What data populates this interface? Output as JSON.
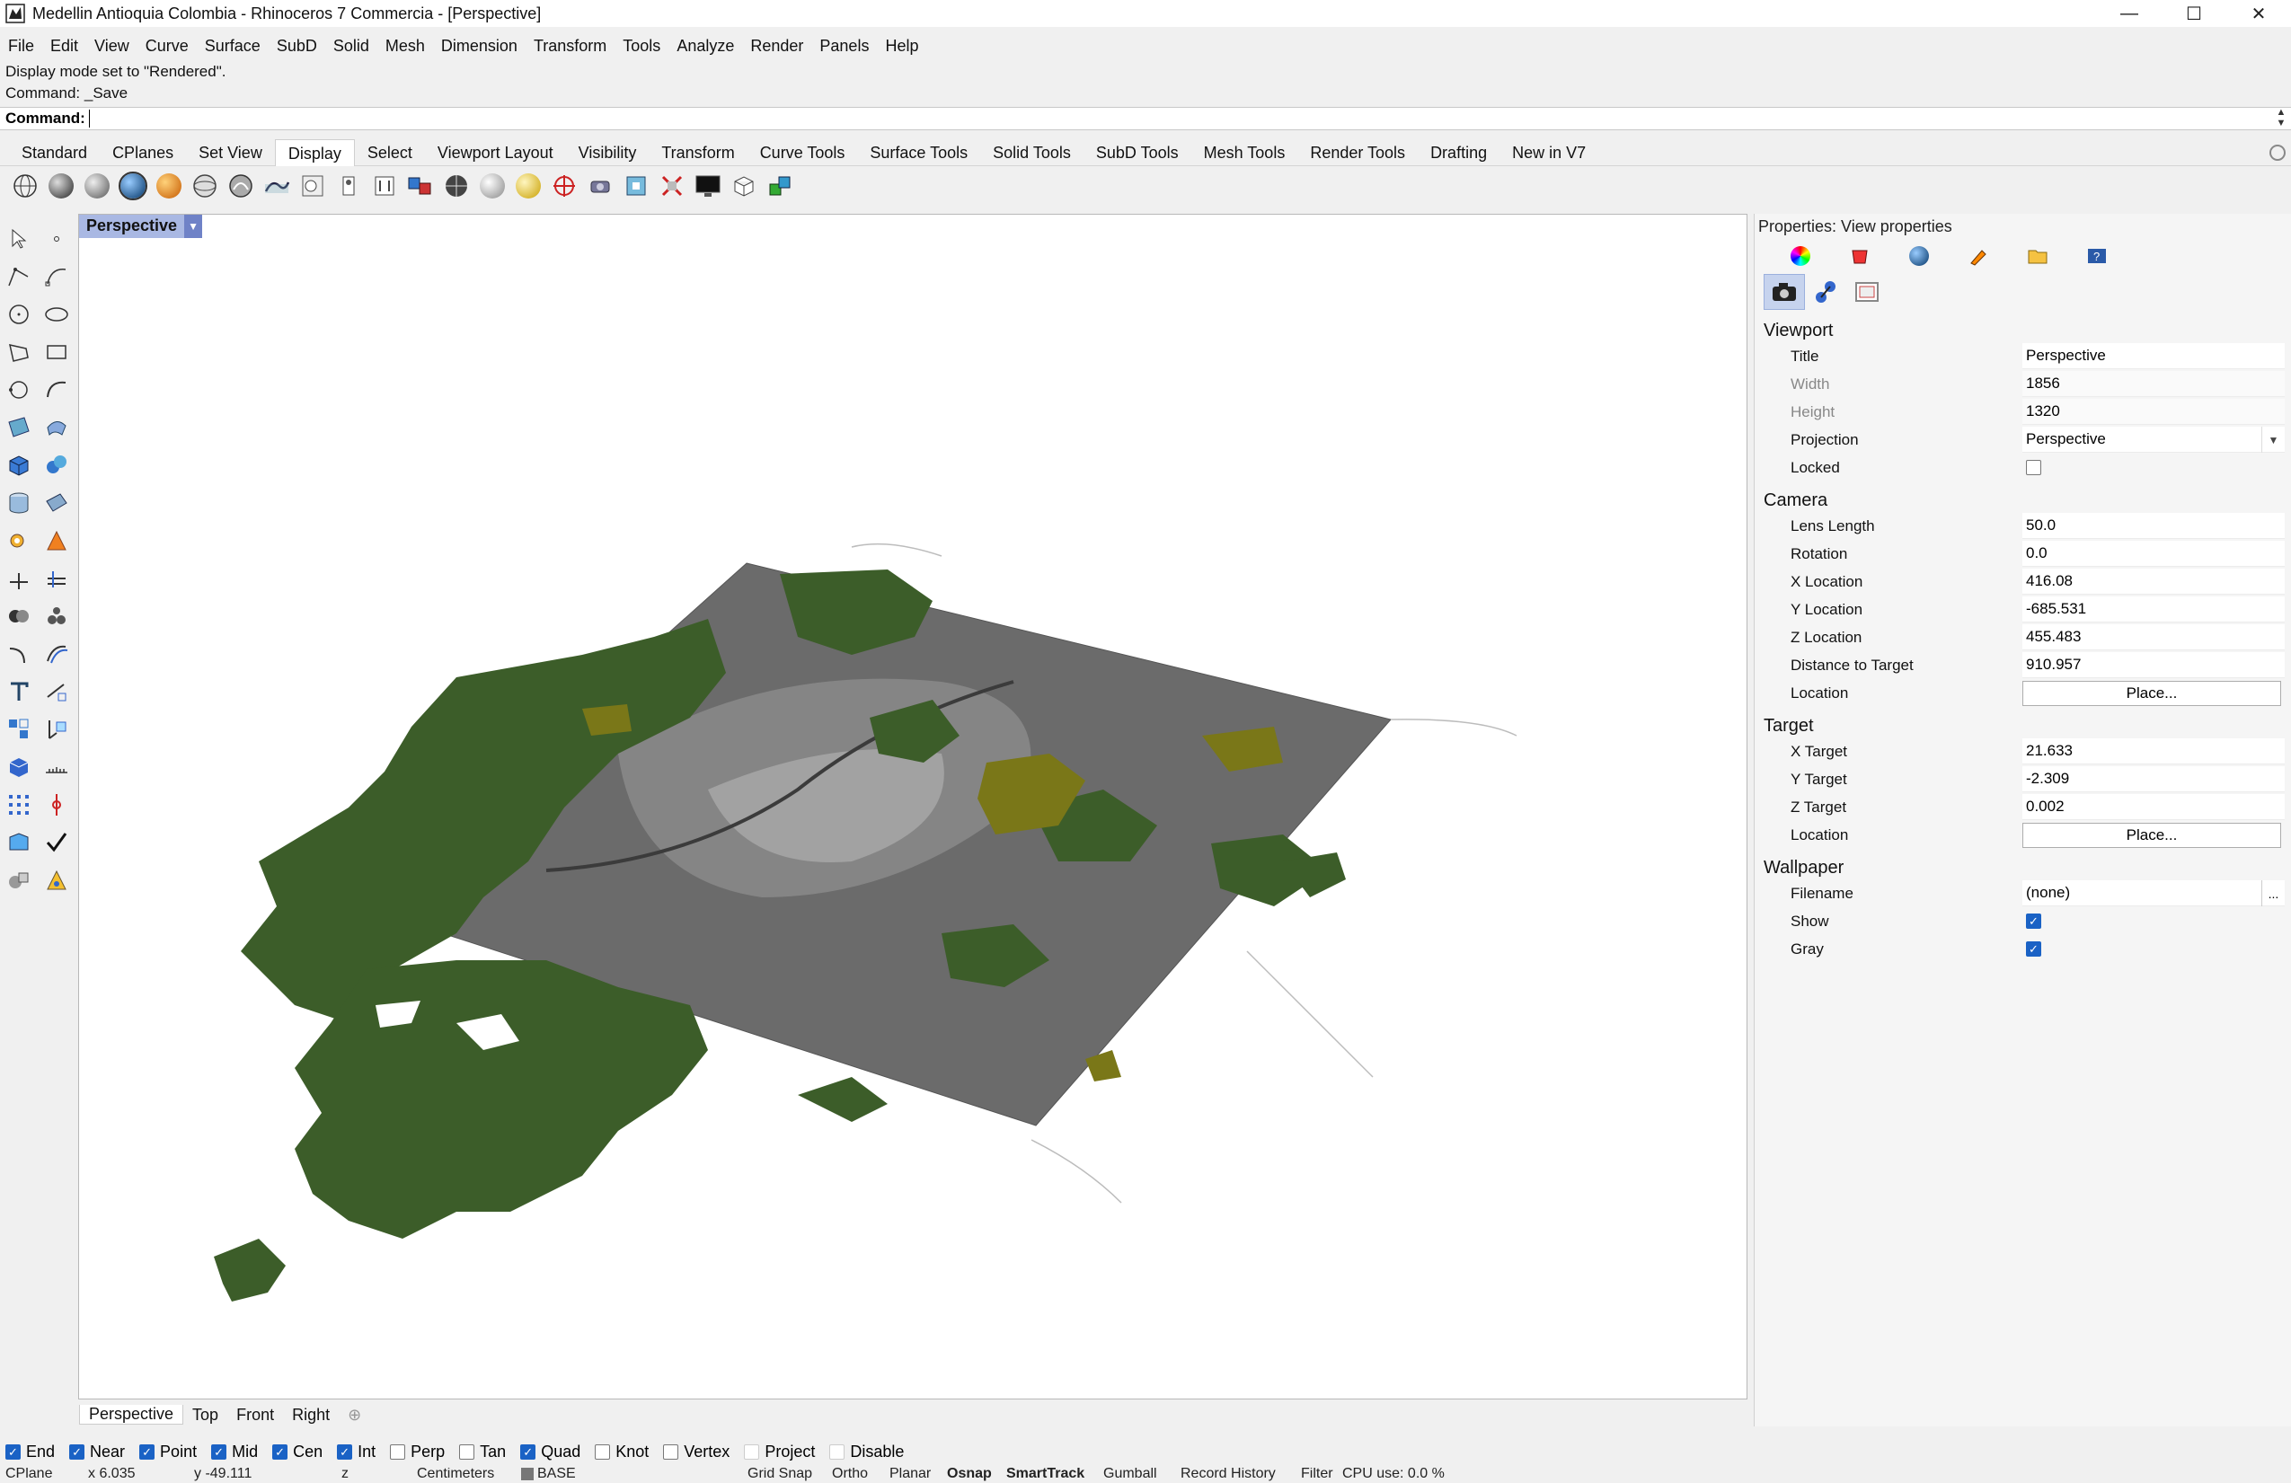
{
  "window": {
    "title": "Medellin Antioquia Colombia - Rhinoceros 7 Commercia - [Perspective]",
    "minimize": "—",
    "maximize": "☐",
    "close": "✕"
  },
  "menu": [
    "File",
    "Edit",
    "View",
    "Curve",
    "Surface",
    "SubD",
    "Solid",
    "Mesh",
    "Dimension",
    "Transform",
    "Tools",
    "Analyze",
    "Render",
    "Panels",
    "Help"
  ],
  "command": {
    "history": [
      "Display mode set to \"Rendered\".",
      "Command: _Save"
    ],
    "label": "Command:",
    "value": ""
  },
  "toolbar_tabs": [
    "Standard",
    "CPlanes",
    "Set View",
    "Display",
    "Select",
    "Viewport Layout",
    "Visibility",
    "Transform",
    "Curve Tools",
    "Surface Tools",
    "Solid Tools",
    "SubD Tools",
    "Mesh Tools",
    "Render Tools",
    "Drafting",
    "New in V7"
  ],
  "active_toolbar_tab": "Display",
  "display_toolbar_icons": [
    "wireframe-icon",
    "shaded-icon",
    "rendered-icon",
    "ghosted-icon",
    "xray-icon",
    "technical-icon",
    "artistic-icon",
    "pen-icon",
    "arctic-icon",
    "raytraced-icon",
    "monochrome-icon",
    "lights-icon",
    "display-options-icon",
    "environment-icon",
    "sun-icon",
    "cplane-icon",
    "camera-icon",
    "zoom-icon",
    "clipping-icon",
    "monitor-icon",
    "box-icon",
    "layers-icon"
  ],
  "viewport": {
    "title": "Perspective",
    "tabs": [
      "Perspective",
      "Top",
      "Front",
      "Right"
    ],
    "add_tab": "⊕",
    "colors": {
      "terrain": "#6d6d6d",
      "forest": "#3d5e2a",
      "olive": "#7d7a1c",
      "urban": "#d6d6d6"
    }
  },
  "properties": {
    "title": "Properties: View properties",
    "viewport_section": "Viewport",
    "title_label": "Title",
    "title_value": "Perspective",
    "width_label": "Width",
    "width_value": "1856",
    "height_label": "Height",
    "height_value": "1320",
    "projection_label": "Projection",
    "projection_value": "Perspective",
    "locked_label": "Locked",
    "camera_section": "Camera",
    "lens_label": "Lens Length",
    "lens_value": "50.0",
    "rotation_label": "Rotation",
    "rotation_value": "0.0",
    "xloc_label": "X Location",
    "xloc_value": "416.08",
    "yloc_label": "Y Location",
    "yloc_value": "-685.531",
    "zloc_label": "Z Location",
    "zloc_value": "455.483",
    "dist_label": "Distance to Target",
    "dist_value": "910.957",
    "location_label": "Location",
    "place_label": "Place...",
    "target_section": "Target",
    "xt_label": "X Target",
    "xt_value": "21.633",
    "yt_label": "Y Target",
    "yt_value": "-2.309",
    "zt_label": "Z Target",
    "zt_value": "0.002",
    "wallpaper_section": "Wallpaper",
    "filename_label": "Filename",
    "filename_value": "(none)",
    "browse": "...",
    "show_label": "Show",
    "gray_label": "Gray",
    "check": "✓"
  },
  "osnap": [
    {
      "label": "End",
      "checked": true
    },
    {
      "label": "Near",
      "checked": true
    },
    {
      "label": "Point",
      "checked": true
    },
    {
      "label": "Mid",
      "checked": true
    },
    {
      "label": "Cen",
      "checked": true
    },
    {
      "label": "Int",
      "checked": true
    },
    {
      "label": "Perp",
      "checked": false
    },
    {
      "label": "Tan",
      "checked": false
    },
    {
      "label": "Quad",
      "checked": true
    },
    {
      "label": "Knot",
      "checked": false
    },
    {
      "label": "Vertex",
      "checked": false
    },
    {
      "label": "Project",
      "checked": false
    },
    {
      "label": "Disable",
      "checked": false
    }
  ],
  "status": {
    "cplane": "CPlane",
    "x": "x 6.035",
    "y": "y -49.111",
    "z": "z",
    "units": "Centimeters",
    "layer": "BASE",
    "grid_snap": "Grid Snap",
    "ortho": "Ortho",
    "planar": "Planar",
    "osnap": "Osnap",
    "smarttrack": "SmartTrack",
    "gumball": "Gumball",
    "record_history": "Record History",
    "filter": "Filter",
    "cpu": "CPU use: 0.0 %"
  }
}
